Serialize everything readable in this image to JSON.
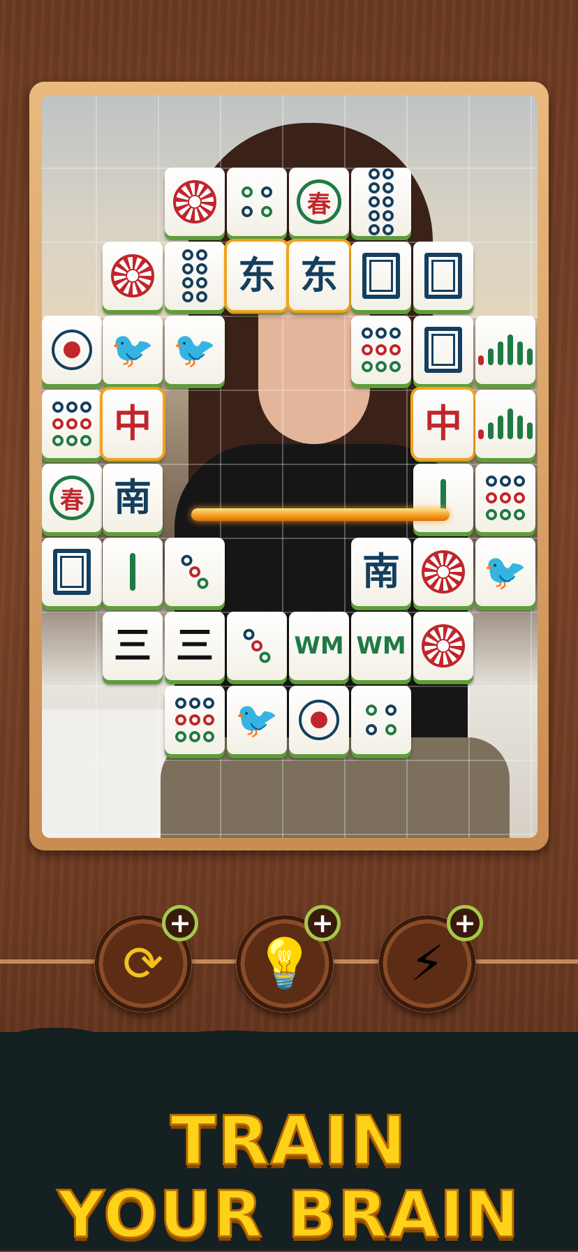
{
  "game": {
    "colors": {
      "tile_accent_green": "#5e9e3a",
      "selection": "#f3a21c",
      "slogan": "#ffd21a",
      "wood": "#7a4328"
    },
    "tiles": [
      {
        "id": "r0c2",
        "kind": "circle-red"
      },
      {
        "id": "r0c3",
        "kind": "dots4"
      },
      {
        "id": "r0c4",
        "kind": "spring",
        "label": "春"
      },
      {
        "id": "r0c5",
        "kind": "dots9"
      },
      {
        "id": "r1c1",
        "kind": "circle-red"
      },
      {
        "id": "r1c2",
        "kind": "dots8"
      },
      {
        "id": "r1c3",
        "kind": "char",
        "label": "东",
        "selected": true
      },
      {
        "id": "r1c4",
        "kind": "char",
        "label": "东",
        "selected": true
      },
      {
        "id": "r1c5",
        "kind": "square"
      },
      {
        "id": "r1c6",
        "kind": "square"
      },
      {
        "id": "r2c0",
        "kind": "one-dot"
      },
      {
        "id": "r2c1",
        "kind": "bird"
      },
      {
        "id": "r2c2",
        "kind": "bird"
      },
      {
        "id": "r2c5",
        "kind": "dots9-mixed"
      },
      {
        "id": "r2c6",
        "kind": "square"
      },
      {
        "id": "r2c7",
        "kind": "bamboo"
      },
      {
        "id": "r3c0",
        "kind": "dots9-mixed"
      },
      {
        "id": "r3c1",
        "kind": "char-red",
        "label": "中",
        "selected": true
      },
      {
        "id": "r3c6",
        "kind": "char-red",
        "label": "中",
        "selected": true
      },
      {
        "id": "r3c7",
        "kind": "bamboo"
      },
      {
        "id": "r4c0",
        "kind": "spring",
        "label": "春"
      },
      {
        "id": "r4c1",
        "kind": "char",
        "label": "南"
      },
      {
        "id": "r4c6",
        "kind": "bamboo2"
      },
      {
        "id": "r4c7",
        "kind": "dots9-mixed"
      },
      {
        "id": "r5c0",
        "kind": "square"
      },
      {
        "id": "r5c1",
        "kind": "bamboo2"
      },
      {
        "id": "r5c2",
        "kind": "dots3"
      },
      {
        "id": "r5c5",
        "kind": "char",
        "label": "南"
      },
      {
        "id": "r5c6",
        "kind": "circle-red"
      },
      {
        "id": "r5c7",
        "kind": "bird"
      },
      {
        "id": "r6c1",
        "kind": "char-black",
        "label": "三"
      },
      {
        "id": "r6c2",
        "kind": "char-black",
        "label": "三"
      },
      {
        "id": "r6c3",
        "kind": "dots3"
      },
      {
        "id": "r6c4",
        "kind": "char-green",
        "label": "WM"
      },
      {
        "id": "r6c5",
        "kind": "char-green",
        "label": "WM"
      },
      {
        "id": "r6c6",
        "kind": "circle-red"
      },
      {
        "id": "r7c2",
        "kind": "dots9-mixed"
      },
      {
        "id": "r7c3",
        "kind": "bird"
      },
      {
        "id": "r7c4",
        "kind": "one-dot"
      },
      {
        "id": "r7c5",
        "kind": "dots4"
      }
    ]
  },
  "toolbar": {
    "shuffle": {
      "icon": "shuffle-arrows-icon",
      "glyph": "⟳",
      "plus": "+"
    },
    "hint": {
      "icon": "lightbulb-icon",
      "glyph": "💡",
      "plus": "+"
    },
    "power": {
      "icon": "lightning-icon",
      "glyph": "⚡",
      "plus": "+"
    }
  },
  "slogan": {
    "line1": "TRAIN",
    "line2": "YOUR BRAIN"
  }
}
